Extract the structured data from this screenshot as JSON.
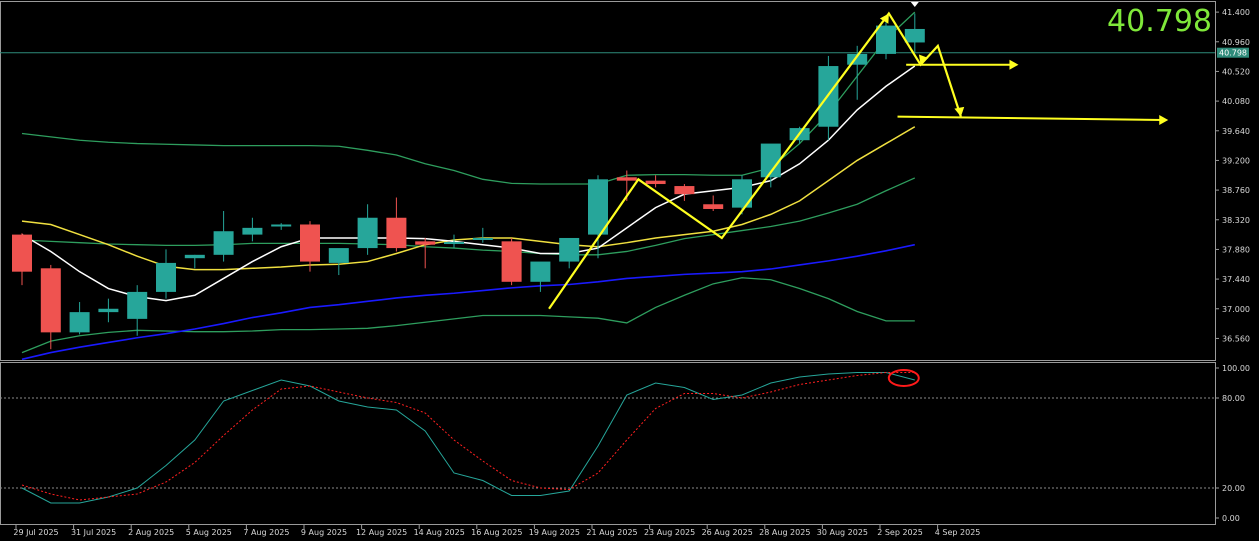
{
  "symbol_price": "40.798",
  "price_tag": "40.798",
  "colors": {
    "bull": "#26a69a",
    "bear": "#ef5350",
    "ma_white": "#ffffff",
    "ma_yellow": "#f0e040",
    "ma_blue": "#1a1aff",
    "bands": "#2e9e5e",
    "stoch_main": "#26a69a",
    "stoch_signal": "#ff2020",
    "annotation": "#ffff20",
    "highlight_circle": "#ff1a1a",
    "price_line": "#2e8b7a",
    "big_price": "#7fe83a"
  },
  "chart_data": {
    "type": "candlestick",
    "y_ticks": [
      "41.400",
      "40.960",
      "40.520",
      "40.080",
      "39.640",
      "39.200",
      "38.760",
      "38.320",
      "37.880",
      "37.440",
      "37.000",
      "36.560"
    ],
    "ylim": [
      36.24,
      41.55
    ],
    "x_labels": [
      "29 Jul 2025",
      "31 Jul 2025",
      "2 Aug 2025",
      "5 Aug 2025",
      "7 Aug 2025",
      "9 Aug 2025",
      "12 Aug 2025",
      "14 Aug 2025",
      "16 Aug 2025",
      "19 Aug 2025",
      "21 Aug 2025",
      "23 Aug 2025",
      "26 Aug 2025",
      "28 Aug 2025",
      "30 Aug 2025",
      "2 Sep 2025",
      "4 Sep 2025"
    ],
    "candles": [
      {
        "o": 38.1,
        "h": 38.12,
        "l": 37.35,
        "c": 37.55
      },
      {
        "o": 37.6,
        "h": 37.65,
        "l": 36.4,
        "c": 36.65
      },
      {
        "o": 36.65,
        "h": 37.1,
        "l": 36.62,
        "c": 36.95
      },
      {
        "o": 36.95,
        "h": 37.15,
        "l": 36.8,
        "c": 37.0
      },
      {
        "o": 36.85,
        "h": 37.35,
        "l": 36.6,
        "c": 37.25
      },
      {
        "o": 37.25,
        "h": 37.88,
        "l": 37.15,
        "c": 37.68
      },
      {
        "o": 37.75,
        "h": 37.8,
        "l": 37.6,
        "c": 37.8
      },
      {
        "o": 37.8,
        "h": 38.45,
        "l": 37.7,
        "c": 38.15
      },
      {
        "o": 38.1,
        "h": 38.35,
        "l": 38.0,
        "c": 38.2
      },
      {
        "o": 38.22,
        "h": 38.27,
        "l": 38.17,
        "c": 38.25
      },
      {
        "o": 38.25,
        "h": 38.3,
        "l": 37.55,
        "c": 37.7
      },
      {
        "o": 37.68,
        "h": 37.85,
        "l": 37.5,
        "c": 37.9
      },
      {
        "o": 37.9,
        "h": 38.55,
        "l": 37.8,
        "c": 38.35
      },
      {
        "o": 38.35,
        "h": 38.65,
        "l": 37.85,
        "c": 37.9
      },
      {
        "o": 38.0,
        "h": 38.05,
        "l": 37.6,
        "c": 37.95
      },
      {
        "o": 37.97,
        "h": 38.1,
        "l": 37.9,
        "c": 37.99
      },
      {
        "o": 38.02,
        "h": 38.2,
        "l": 37.98,
        "c": 38.05
      },
      {
        "o": 38.0,
        "h": 38.05,
        "l": 37.35,
        "c": 37.4
      },
      {
        "o": 37.4,
        "h": 37.65,
        "l": 37.25,
        "c": 37.7
      },
      {
        "o": 37.7,
        "h": 37.95,
        "l": 37.6,
        "c": 38.05
      },
      {
        "o": 38.1,
        "h": 38.98,
        "l": 37.75,
        "c": 38.92
      },
      {
        "o": 38.95,
        "h": 39.05,
        "l": 38.6,
        "c": 38.9
      },
      {
        "o": 38.9,
        "h": 38.98,
        "l": 38.8,
        "c": 38.85
      },
      {
        "o": 38.82,
        "h": 38.85,
        "l": 38.6,
        "c": 38.7
      },
      {
        "o": 38.55,
        "h": 38.68,
        "l": 38.45,
        "c": 38.48
      },
      {
        "o": 38.5,
        "h": 38.98,
        "l": 38.4,
        "c": 38.92
      },
      {
        "o": 38.95,
        "h": 39.42,
        "l": 38.8,
        "c": 39.45
      },
      {
        "o": 39.5,
        "h": 39.7,
        "l": 39.45,
        "c": 39.68
      },
      {
        "o": 39.7,
        "h": 40.75,
        "l": 39.5,
        "c": 40.6
      },
      {
        "o": 40.62,
        "h": 40.9,
        "l": 40.1,
        "c": 40.78
      },
      {
        "o": 40.78,
        "h": 41.25,
        "l": 40.7,
        "c": 41.2
      },
      {
        "o": 40.95,
        "h": 41.38,
        "l": 40.8,
        "c": 41.15
      }
    ],
    "ma_white": [
      38.1,
      37.85,
      37.55,
      37.3,
      37.18,
      37.12,
      37.2,
      37.45,
      37.7,
      37.92,
      38.05,
      38.05,
      38.05,
      38.05,
      38.04,
      38.0,
      37.95,
      37.9,
      37.82,
      37.82,
      37.9,
      38.2,
      38.5,
      38.7,
      38.75,
      38.8,
      38.9,
      39.15,
      39.5,
      39.95,
      40.3,
      40.6
    ],
    "ma_yellow": [
      38.3,
      38.25,
      38.1,
      37.95,
      37.78,
      37.63,
      37.58,
      37.58,
      37.6,
      37.62,
      37.65,
      37.66,
      37.7,
      37.82,
      37.95,
      38.02,
      38.05,
      38.05,
      38.0,
      37.95,
      37.92,
      37.98,
      38.05,
      38.1,
      38.15,
      38.25,
      38.4,
      38.6,
      38.9,
      39.2,
      39.45,
      39.7
    ],
    "ma_blue": [
      36.25,
      36.35,
      36.43,
      36.5,
      36.57,
      36.63,
      36.7,
      36.78,
      36.87,
      36.94,
      37.02,
      37.06,
      37.11,
      37.16,
      37.2,
      37.23,
      37.27,
      37.31,
      37.34,
      37.36,
      37.4,
      37.45,
      37.48,
      37.51,
      37.53,
      37.55,
      37.59,
      37.65,
      37.71,
      37.78,
      37.86,
      37.95
    ],
    "band_upper": [
      39.6,
      39.55,
      39.5,
      39.47,
      39.45,
      39.44,
      39.43,
      39.42,
      39.42,
      39.42,
      39.42,
      39.41,
      39.35,
      39.28,
      39.15,
      39.05,
      38.92,
      38.86,
      38.85,
      38.85,
      38.85,
      38.98,
      38.99,
      38.99,
      38.98,
      38.98,
      39.09,
      39.45,
      39.9,
      40.45,
      41.0,
      41.4
    ],
    "band_mid": [
      38.02,
      38.0,
      37.98,
      37.96,
      37.95,
      37.94,
      37.94,
      37.95,
      37.97,
      37.97,
      37.97,
      37.97,
      37.96,
      37.95,
      37.92,
      37.9,
      37.87,
      37.85,
      37.82,
      37.8,
      37.8,
      37.85,
      37.94,
      38.04,
      38.1,
      38.16,
      38.22,
      38.3,
      38.42,
      38.55,
      38.75,
      38.94
    ],
    "band_lower": [
      36.35,
      36.52,
      36.6,
      36.65,
      36.68,
      36.67,
      36.66,
      36.66,
      36.67,
      36.69,
      36.69,
      36.7,
      36.71,
      36.75,
      36.8,
      36.85,
      36.9,
      36.9,
      36.9,
      36.88,
      36.86,
      36.79,
      37.02,
      37.2,
      37.37,
      37.46,
      37.43,
      37.3,
      37.15,
      36.96,
      36.82,
      36.82
    ],
    "stoch": {
      "y_ticks": [
        "100.00",
        "80.00",
        "20.00",
        "0.00"
      ],
      "levels": [
        80,
        20
      ],
      "main": [
        20,
        10,
        10,
        14,
        20,
        35,
        52,
        78,
        85,
        92,
        88,
        78,
        74,
        72,
        58,
        30,
        25,
        15,
        15,
        18,
        48,
        82,
        90,
        87,
        79,
        82,
        90,
        94,
        96,
        97,
        97,
        92
      ],
      "signal": [
        22,
        16,
        12,
        14,
        16,
        24,
        37,
        55,
        72,
        86,
        88,
        84,
        80,
        77,
        70,
        52,
        38,
        25,
        20,
        19,
        30,
        52,
        73,
        83,
        83,
        80,
        84,
        89,
        92,
        95,
        97,
        97
      ],
      "highlight_index": 31
    }
  }
}
